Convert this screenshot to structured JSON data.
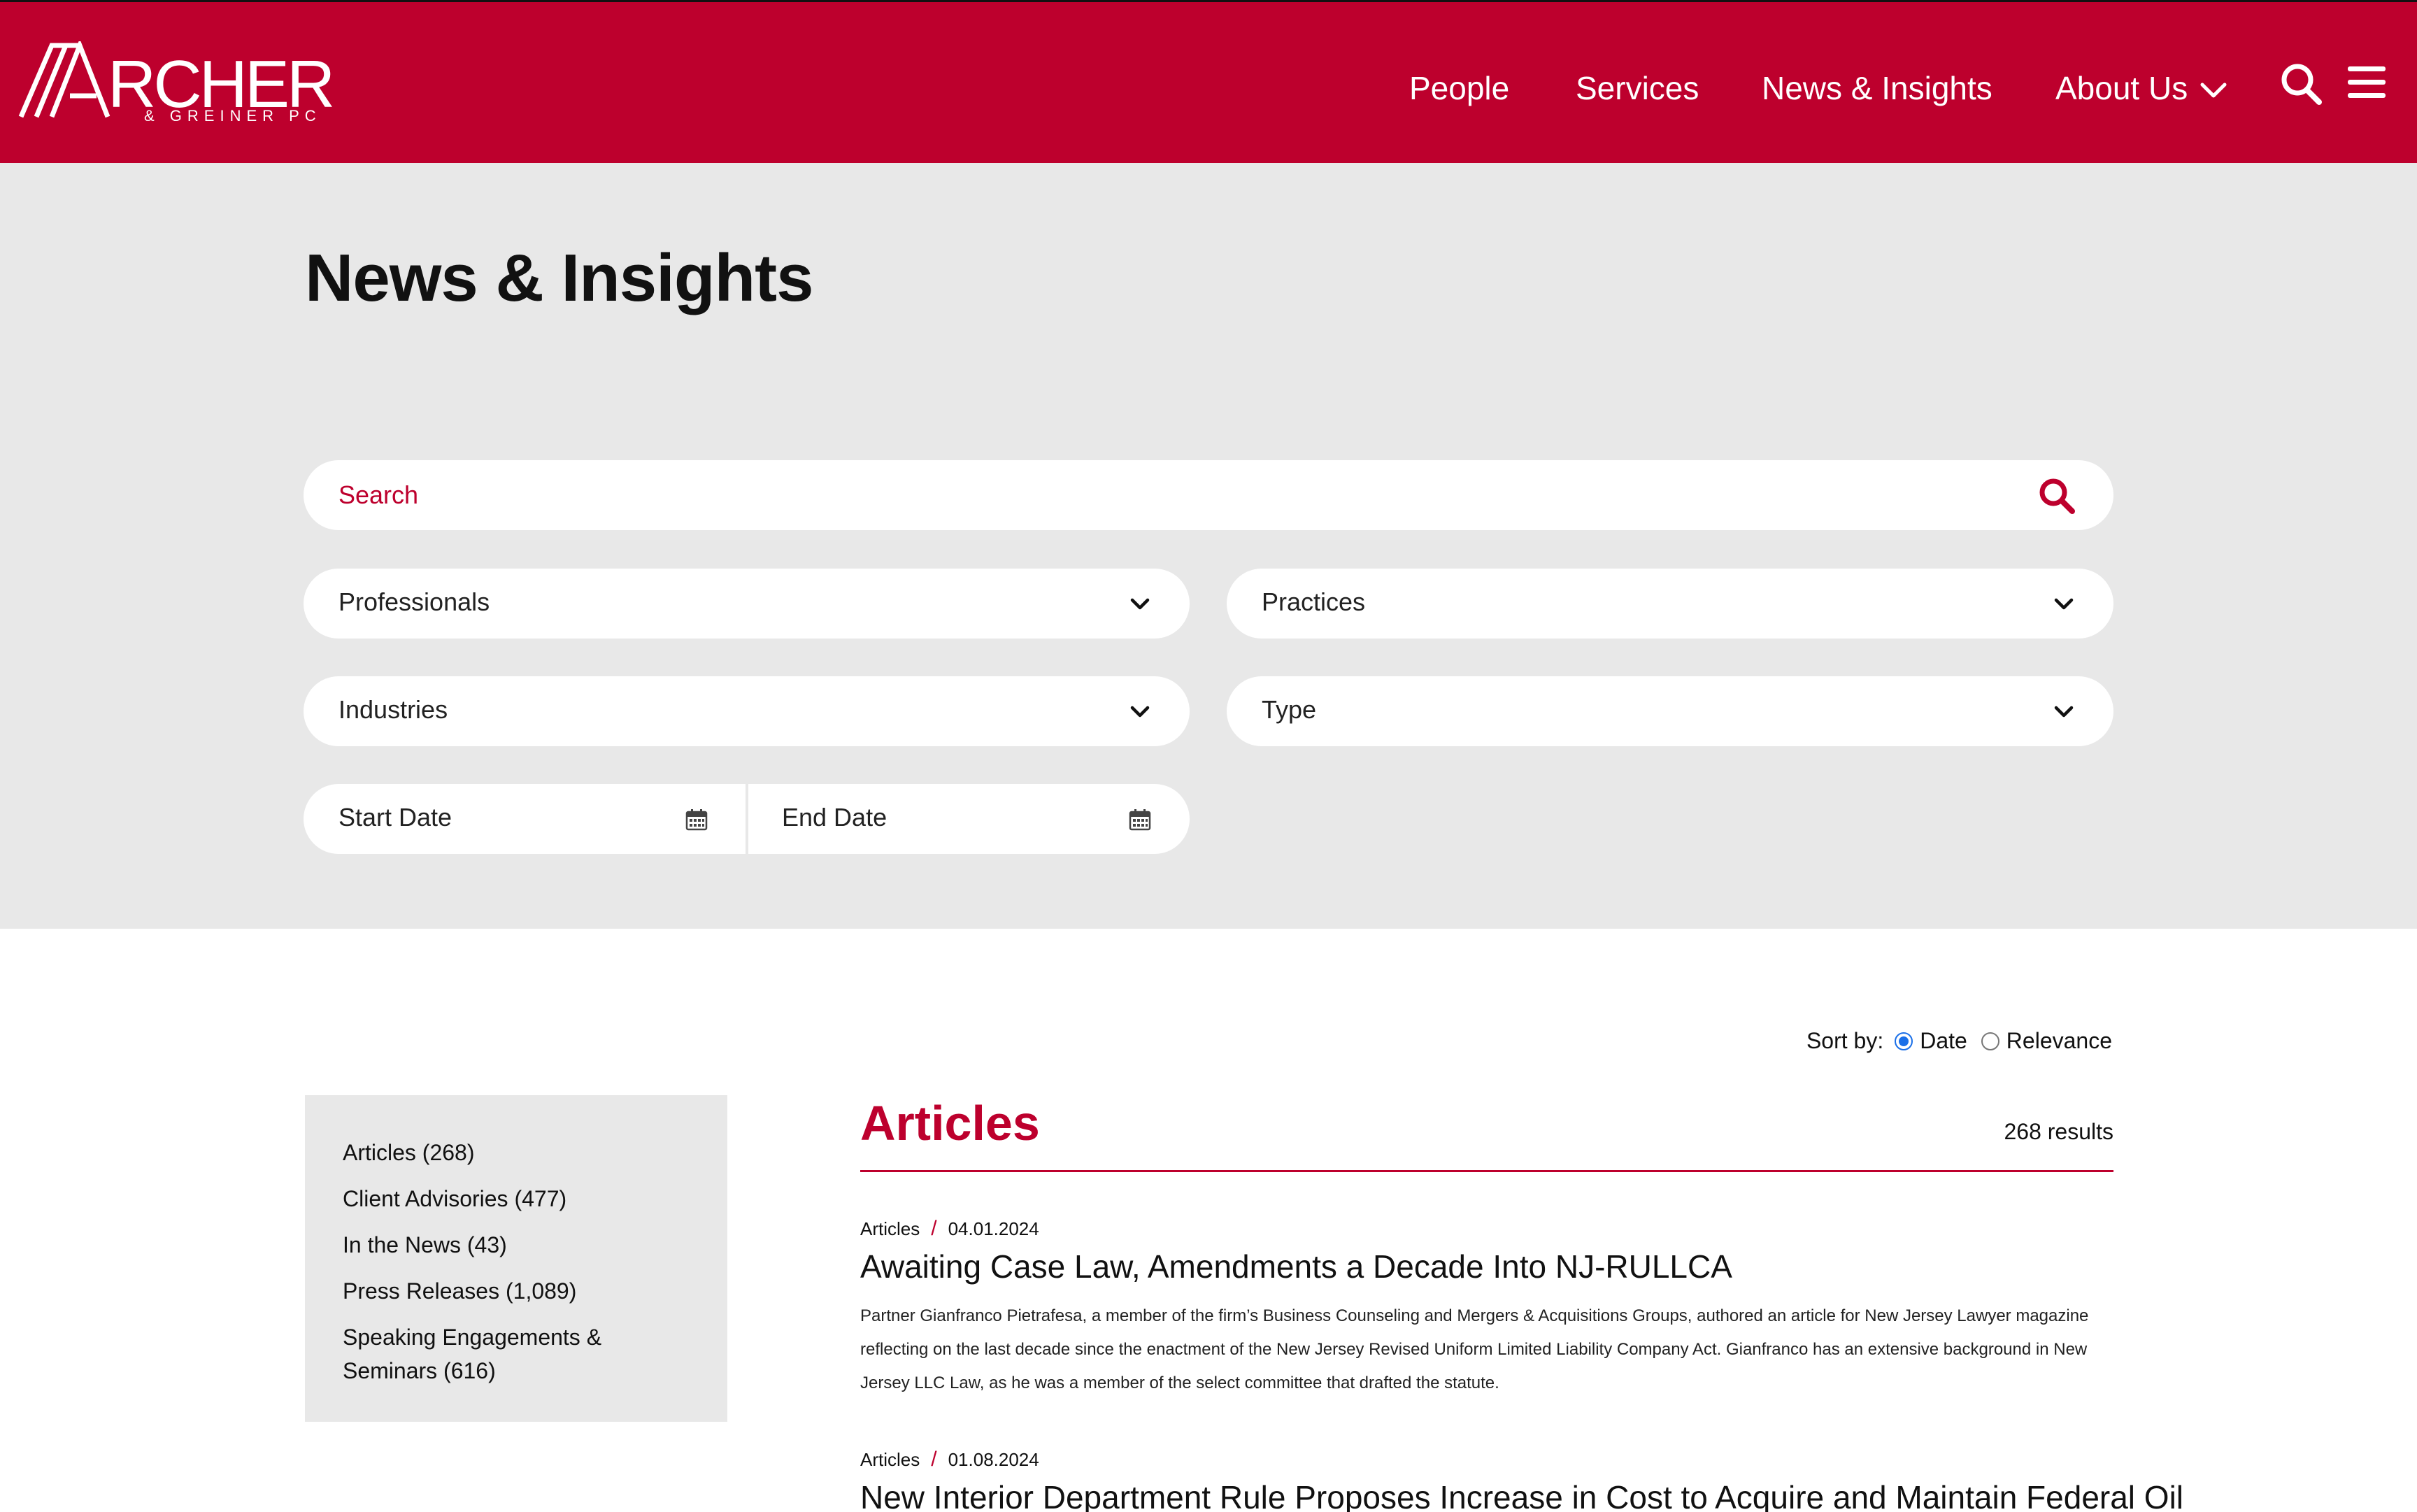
{
  "header": {
    "brand_text": "ARCHER & GREINER PC",
    "nav": [
      "People",
      "Services",
      "News & Insights",
      "About Us"
    ],
    "brand_color": "#bd002d",
    "icons": [
      "chevron-down-icon",
      "search-icon",
      "menu-icon"
    ]
  },
  "hero": {
    "title": "News & Insights",
    "search_placeholder": "Search",
    "filters": {
      "professionals": "Professionals",
      "practices": "Practices",
      "industries": "Industries",
      "type": "Type",
      "start_date": "Start Date",
      "end_date": "End Date"
    }
  },
  "sort": {
    "label": "Sort by:",
    "options": [
      "Date",
      "Relevance"
    ],
    "selected": "Date"
  },
  "sidebar": {
    "items": [
      "Articles (268)",
      "Client Advisories (477)",
      "In the News (43)",
      "Press Releases (1,089)",
      "Speaking Engagements & Seminars (616)"
    ]
  },
  "results": {
    "heading": "Articles",
    "count": "268 results",
    "items": [
      {
        "type": "Articles",
        "date": "04.01.2024",
        "title": "Awaiting Case Law, Amendments a Decade Into NJ-RULLCA",
        "summary": "Partner Gianfranco Pietrafesa, a member of the firm’s Business Counseling and Mergers & Acquisitions Groups, authored an article for New Jersey Lawyer magazine reflecting on the last decade since the enactment of the New Jersey Revised Uniform Limited Liability Company Act. Gianfranco has an extensive background in New Jersey LLC Law, as he was a member of the select committee that drafted the statute."
      },
      {
        "type": "Articles",
        "date": "01.08.2024",
        "title": "New Interior Department Rule Proposes Increase in Cost to Acquire and Maintain Federal Oil"
      }
    ]
  }
}
